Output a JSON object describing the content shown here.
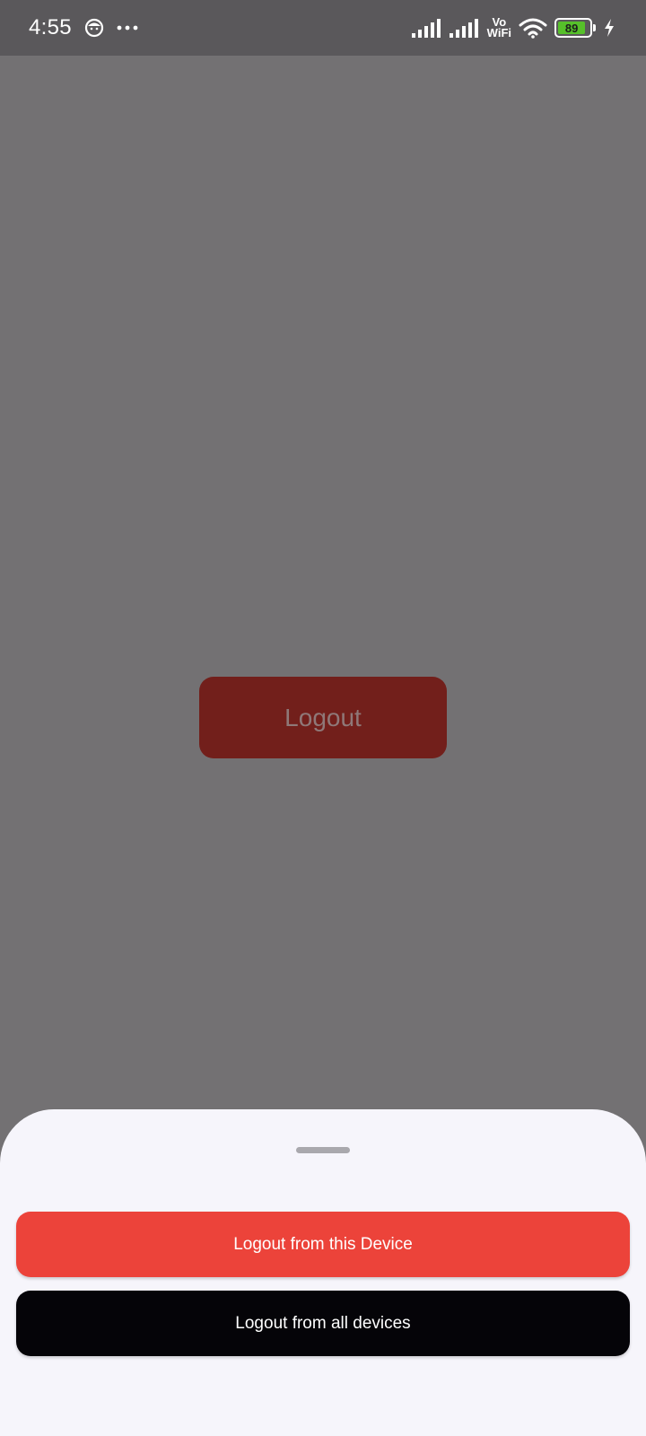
{
  "status_bar": {
    "time": "4:55",
    "vowifi_top": "Vo",
    "vowifi_bottom": "WiFi",
    "battery_level": "89",
    "battery_color": "#56c02a",
    "icons": [
      "face-app-icon",
      "more-dots-icon",
      "signal-icon",
      "signal-icon",
      "wifi-icon",
      "battery-icon",
      "charging-bolt-icon"
    ]
  },
  "background": {
    "logout_button_label": "Logout"
  },
  "bottom_sheet": {
    "logout_this_device_label": "Logout from this Device",
    "logout_all_devices_label": "Logout from all devices"
  },
  "colors": {
    "scrim": "#737173",
    "danger": "#ec433a",
    "dark": "#050408",
    "sheet": "#f6f5fb"
  }
}
